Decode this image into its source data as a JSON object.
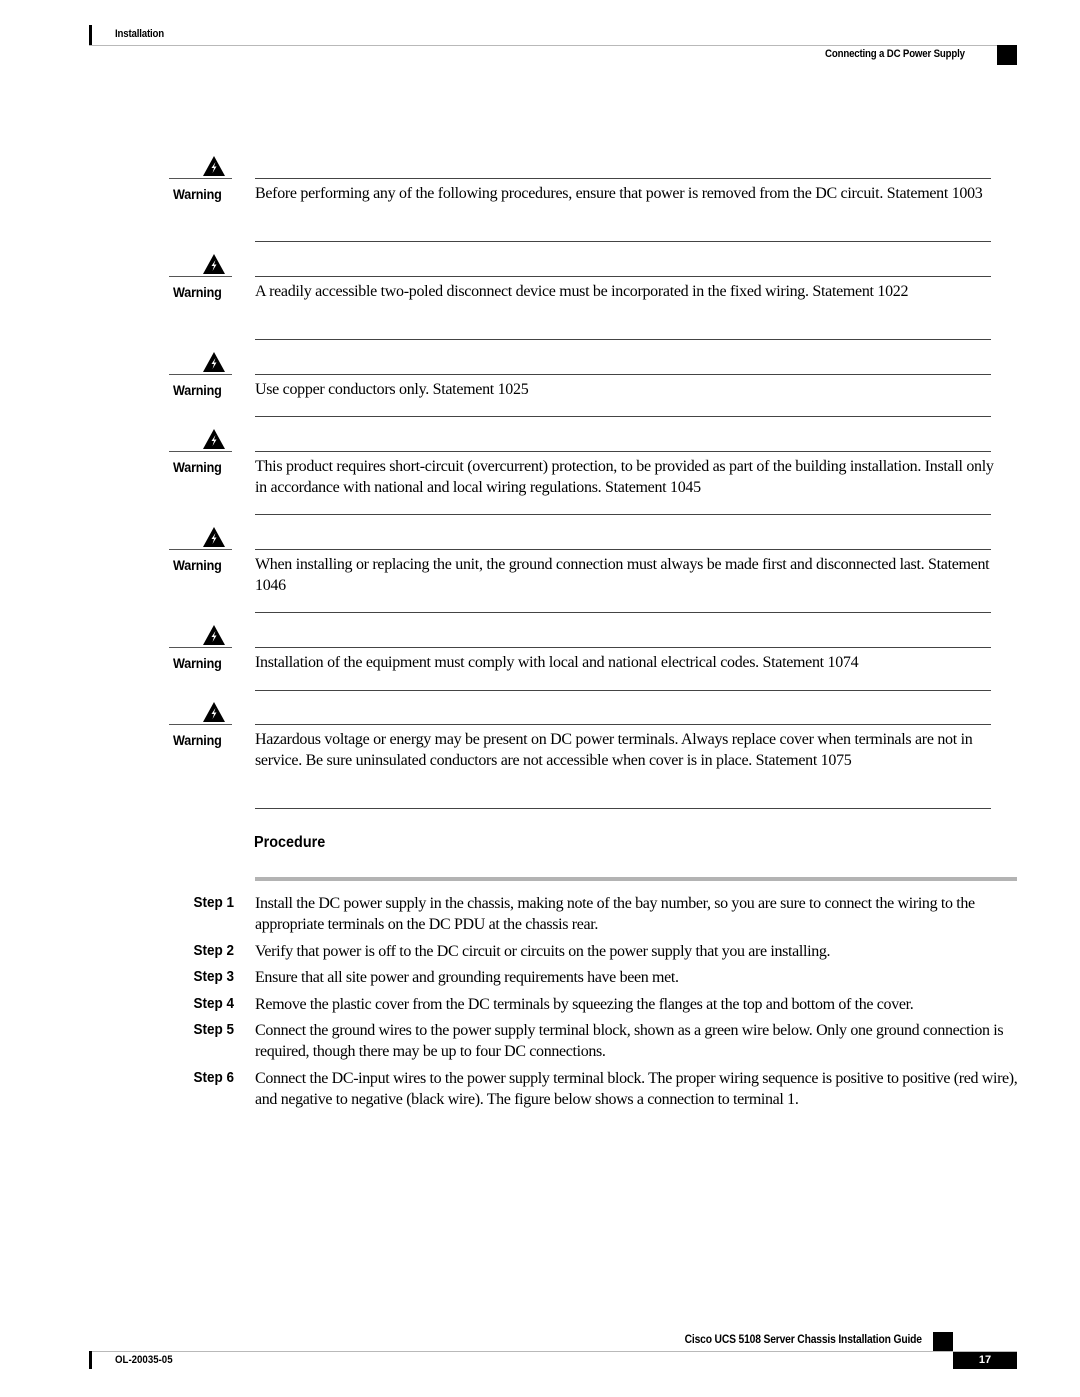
{
  "header": {
    "chapter": "Installation",
    "section": "Connecting a DC Power Supply"
  },
  "warnings": [
    {
      "icon": "warning-triangle-icon",
      "label": "Warning",
      "text": "Before performing any of the following procedures, ensure that power is removed from the DC circuit. Statement 1003"
    },
    {
      "icon": "warning-triangle-icon",
      "label": "Warning",
      "text": "A readily accessible two-poled disconnect device must be incorporated in the fixed wiring. Statement 1022"
    },
    {
      "icon": "warning-triangle-icon",
      "label": "Warning",
      "text": "Use copper conductors only. Statement 1025"
    },
    {
      "icon": "warning-triangle-icon",
      "label": "Warning",
      "text": "This product requires short-circuit (overcurrent) protection, to be provided as part of the building installation. Install only in accordance with national and local wiring regulations. Statement 1045"
    },
    {
      "icon": "warning-triangle-icon",
      "label": "Warning",
      "text": "When installing or replacing the unit, the ground connection must always be made first and disconnected last. Statement 1046"
    },
    {
      "icon": "warning-triangle-icon",
      "label": "Warning",
      "text": "Installation of the equipment must comply with local and national electrical codes. Statement 1074"
    },
    {
      "icon": "warning-triangle-icon",
      "label": "Warning",
      "text": "Hazardous voltage or energy may be present on DC power terminals. Always replace cover when terminals are not in service. Be sure uninsulated conductors are not accessible when cover is in place. Statement 1075"
    }
  ],
  "procedure": {
    "title": "Procedure",
    "steps": [
      {
        "label": "Step 1",
        "text": "Install the DC power supply in the chassis, making note of the bay number, so you are sure to connect the wiring to the appropriate terminals on the DC PDU at the chassis rear."
      },
      {
        "label": "Step 2",
        "text": "Verify that power is off to the DC circuit or circuits on the power supply that you are installing."
      },
      {
        "label": "Step 3",
        "text": "Ensure that all site power and grounding requirements have been met."
      },
      {
        "label": "Step 4",
        "text": "Remove the plastic cover from the DC terminals by squeezing the flanges at the top and bottom of the cover."
      },
      {
        "label": "Step 5",
        "text": "Connect the ground wires to the power supply terminal block, shown as a green wire below. Only one ground connection is required, though there may be up to four DC connections."
      },
      {
        "label": "Step 6",
        "text": "Connect the DC-input wires to the power supply terminal block. The proper wiring sequence is positive to positive (red wire), and negative to negative (black wire). The figure below shows a connection to terminal 1."
      }
    ]
  },
  "footer": {
    "guide_title": "Cisco UCS 5108 Server Chassis Installation Guide",
    "doc_number": "OL-20035-05",
    "page_number": "17"
  }
}
